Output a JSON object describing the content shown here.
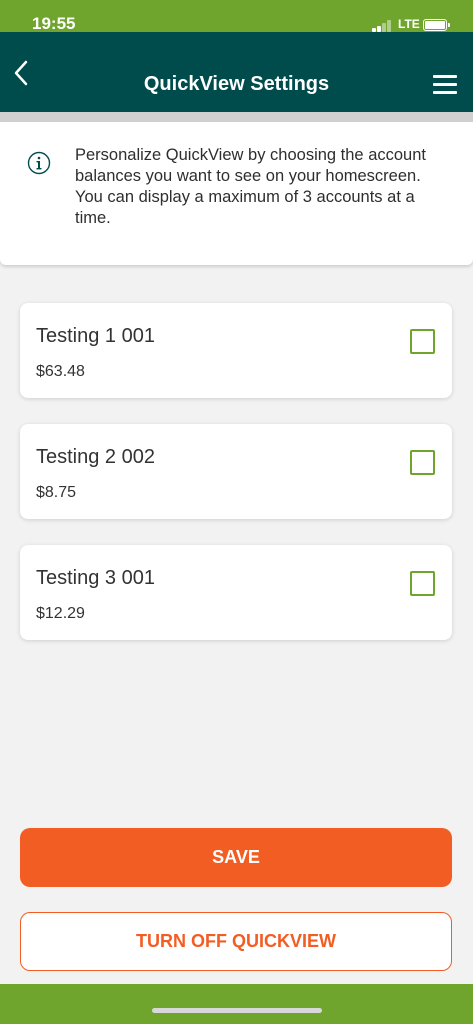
{
  "status_bar": {
    "time": "19:55",
    "network": "LTE",
    "color": "#6fa52d"
  },
  "header": {
    "title": "QuickView Settings",
    "back_icon": "chevron-left-icon",
    "menu_icon": "hamburger-menu-icon",
    "color": "#004c4d"
  },
  "info": {
    "icon": "info-icon",
    "text": "Personalize QuickView by choosing the account balances you want to see on your homescreen. You can display a maximum of 3 accounts at a time."
  },
  "accounts": [
    {
      "name": "Testing 1 001",
      "balance": "$63.48",
      "checked": false
    },
    {
      "name": "Testing 2 002",
      "balance": "$8.75",
      "checked": false
    },
    {
      "name": "Testing 3 001",
      "balance": "$12.29",
      "checked": false
    }
  ],
  "actions": {
    "save_label": "SAVE",
    "turn_off_label": "TURN OFF QUICKVIEW",
    "accent_color": "#f25d23"
  }
}
